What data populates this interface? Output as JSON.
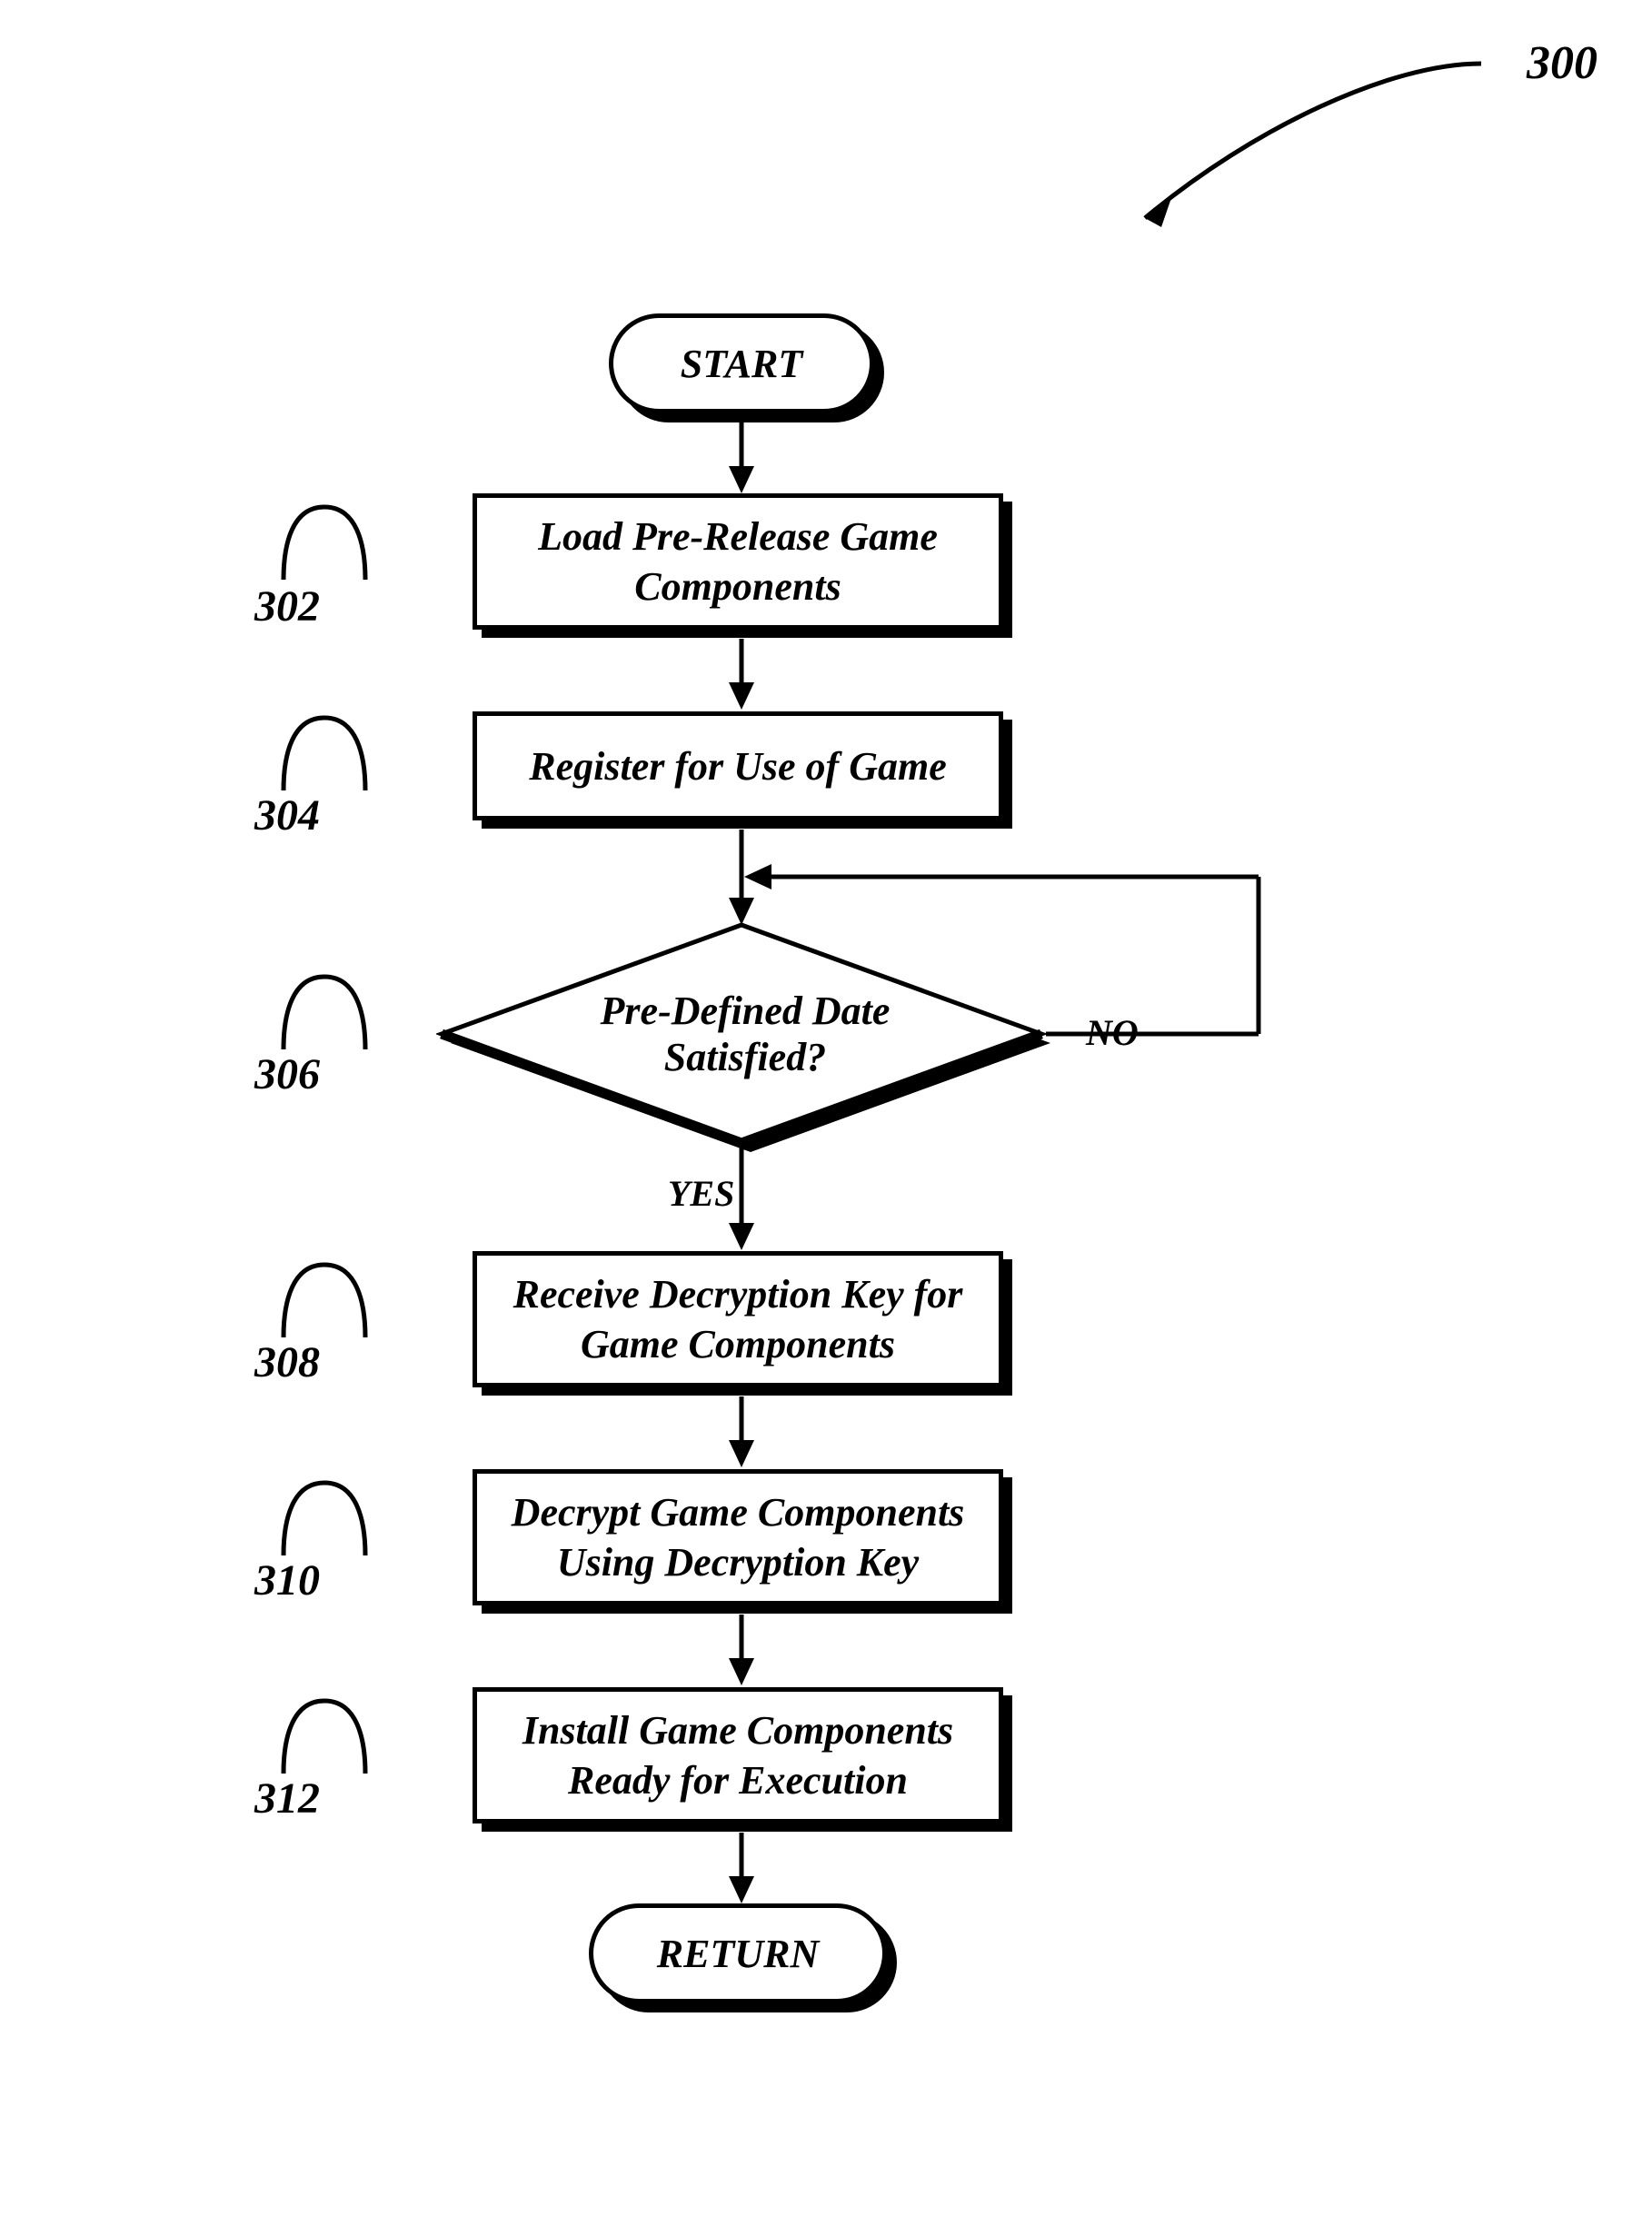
{
  "figure_number": "300",
  "terminals": {
    "start": "START",
    "return": "RETURN"
  },
  "steps": {
    "s302": {
      "ref": "302",
      "line1": "Load Pre-Release Game",
      "line2": "Components"
    },
    "s304": {
      "ref": "304",
      "line1": "Register for Use of Game"
    },
    "s306": {
      "ref": "306",
      "line1": "Pre-Defined Date",
      "line2": "Satisfied?"
    },
    "s308": {
      "ref": "308",
      "line1": "Receive Decryption Key for",
      "line2": "Game Components"
    },
    "s310": {
      "ref": "310",
      "line1": "Decrypt Game Components",
      "line2": "Using Decryption Key"
    },
    "s312": {
      "ref": "312",
      "line1": "Install Game Components",
      "line2": "Ready for Execution"
    }
  },
  "branches": {
    "yes": "YES",
    "no": "NO"
  }
}
